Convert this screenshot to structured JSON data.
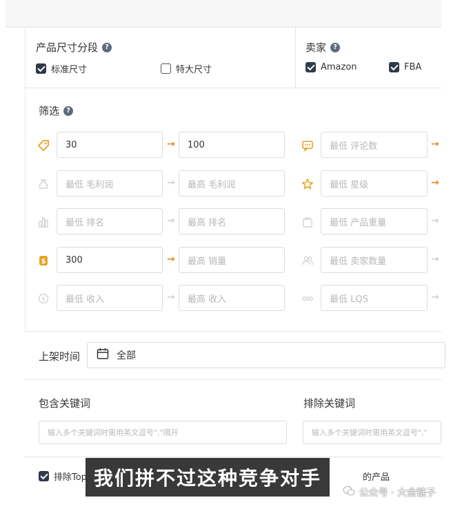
{
  "size_segment": {
    "title": "产品尺寸分段",
    "standard": "标准尺寸",
    "oversize": "特大尺寸"
  },
  "seller": {
    "title": "卖家",
    "amazon": "Amazon",
    "fba": "FBA"
  },
  "filter": {
    "title": "筛选",
    "price_min": "30",
    "price_max": "100",
    "margin_min_ph": "最低 毛利润",
    "margin_max_ph": "最高 毛利润",
    "rank_min_ph": "最低 排名",
    "rank_max_ph": "最高 排名",
    "sales_min": "300",
    "sales_max_ph": "最高 销量",
    "revenue_min_ph": "最低 收入",
    "revenue_max_ph": "最高 收入",
    "reviews_min_ph": "最低 评论数",
    "stars_min_ph": "最低 星级",
    "weight_min_ph": "最低 产品重量",
    "sellers_min_ph": "最低 卖家数量",
    "lqs_min_ph": "最低 LQS"
  },
  "listing_time": {
    "label": "上架时间",
    "value": "全部"
  },
  "keywords": {
    "include_title": "包含关键词",
    "exclude_title": "排除关键词",
    "include_ph": "输入多个关键词时需用英文逗号\",\"隔开",
    "exclude_ph": "输入多个关键词时需用英文逗号\",\""
  },
  "exclude_top": {
    "label": "排除Top",
    "suffix": "的产品"
  },
  "subtitle": "我们拼不过这种竞争对手",
  "watermark": "公众号 · 大金链子",
  "colors": {
    "accent": "#e8851f",
    "check": "#2f3a4a",
    "border": "#dcdcdc"
  }
}
